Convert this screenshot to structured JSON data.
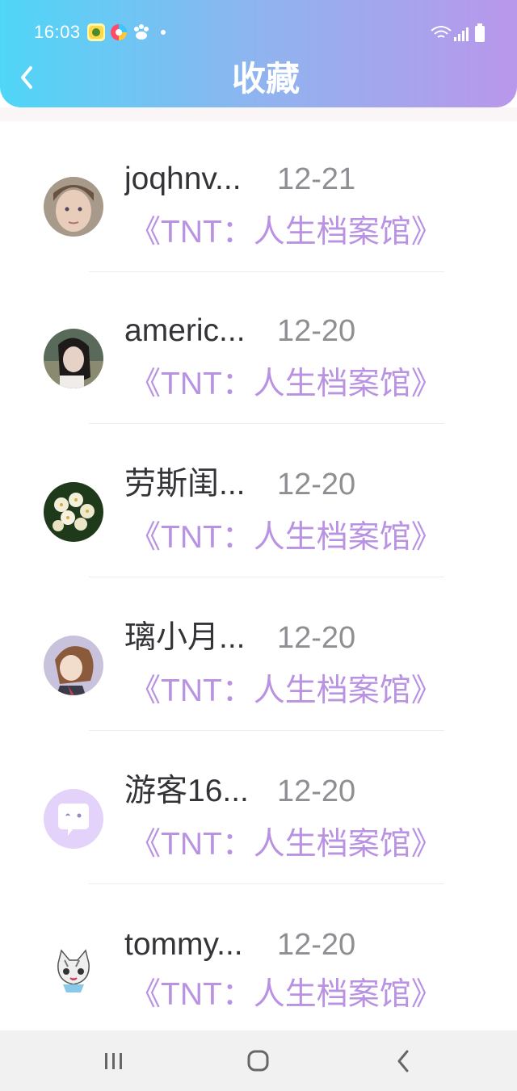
{
  "status_bar": {
    "time": "16:03",
    "icons": [
      "app-icon-yellow",
      "app-icon-colorful",
      "baidu-icon"
    ],
    "right_icons": [
      "wifi-icon",
      "signal-icon",
      "battery-icon"
    ]
  },
  "header": {
    "title": "收藏",
    "back_icon": "chevron-left-icon",
    "gradient_start": "#4fd6f7",
    "gradient_end": "#b997ea"
  },
  "favorites": [
    {
      "name": "joqhnv...",
      "date": "12-21",
      "title": "《TNT：人生档案馆》",
      "avatar": "child-photo"
    },
    {
      "name": "americ...",
      "date": "12-20",
      "title": "《TNT：人生档案馆》",
      "avatar": "girl-photo"
    },
    {
      "name": "劳斯闺...",
      "date": "12-20",
      "title": "《TNT：人生档案馆》",
      "avatar": "flowers-photo"
    },
    {
      "name": "璃小月...",
      "date": "12-20",
      "title": "《TNT：人生档案馆》",
      "avatar": "anime-girl"
    },
    {
      "name": "游客16...",
      "date": "12-20",
      "title": "《TNT：人生档案馆》",
      "avatar": "default-chat-avatar"
    },
    {
      "name": "tommy...",
      "date": "12-20",
      "title": "《TNT：人生档案馆》",
      "avatar": "cartoon-cat"
    }
  ],
  "colors": {
    "title_accent": "#b993e2",
    "name": "#333338",
    "date": "#8e8e93"
  },
  "bottom_nav": [
    "recent-apps-icon",
    "home-icon",
    "back-icon"
  ]
}
